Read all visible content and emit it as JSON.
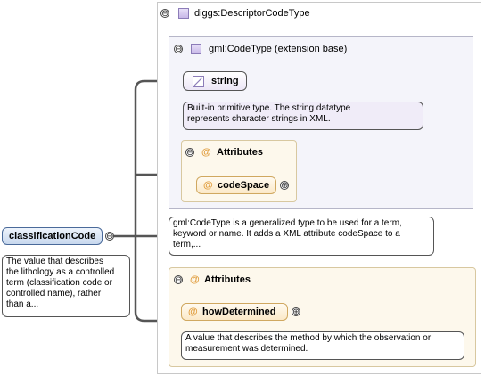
{
  "root_element": {
    "name": "classificationCode",
    "doc": [
      "The value that describes",
      "the lithology as a controlled",
      "term (classification code or",
      "controlled name), rather",
      "than a..."
    ]
  },
  "complex_type": {
    "name": "diggs:DescriptorCodeType",
    "extension": {
      "label": "gml:CodeType (extension base)",
      "base_type": {
        "name": "string",
        "doc": [
          "Built-in primitive type. The string datatype",
          "represents character strings in XML."
        ]
      },
      "attributes": {
        "label": "Attributes",
        "items": [
          {
            "name": "codeSpace"
          }
        ]
      }
    },
    "doc": [
      "gml:CodeType is a generalized type to be used for a term,",
      "keyword or name. It adds a XML attribute codeSpace to a",
      "term,..."
    ],
    "attributes": {
      "label": "Attributes",
      "items": [
        {
          "name": "howDetermined",
          "doc": [
            "A value that describes the method by which the observation or",
            "measurement was determined."
          ]
        }
      ]
    }
  },
  "icons": {
    "collapse": "⊖",
    "expand": "⊕",
    "attribute": "@"
  },
  "colors": {
    "root_fill": "#c8d8ee",
    "attribute_fill": "#fbe9c8",
    "type_fill": "#ece6f6",
    "connector": "#555555"
  }
}
